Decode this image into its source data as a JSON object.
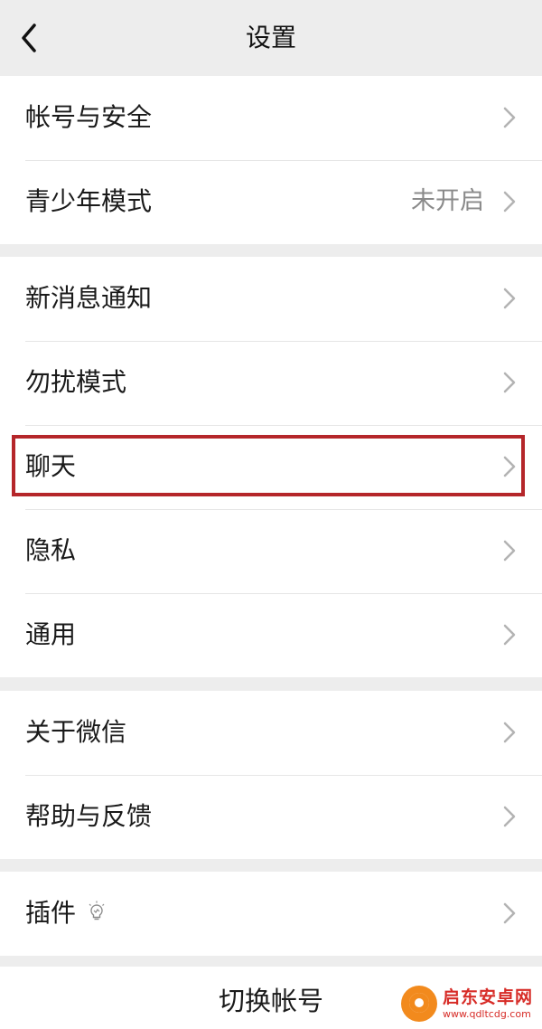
{
  "header": {
    "title": "设置"
  },
  "groups": [
    {
      "items": [
        {
          "label": "帐号与安全",
          "value": ""
        },
        {
          "label": "青少年模式",
          "value": "未开启"
        }
      ]
    },
    {
      "items": [
        {
          "label": "新消息通知",
          "value": ""
        },
        {
          "label": "勿扰模式",
          "value": ""
        },
        {
          "label": "聊天",
          "value": ""
        },
        {
          "label": "隐私",
          "value": ""
        },
        {
          "label": "通用",
          "value": ""
        }
      ]
    },
    {
      "items": [
        {
          "label": "关于微信",
          "value": ""
        },
        {
          "label": "帮助与反馈",
          "value": ""
        }
      ]
    },
    {
      "items": [
        {
          "label": "插件",
          "value": ""
        }
      ]
    }
  ],
  "footer": {
    "switch_account": "切换帐号"
  },
  "watermark": {
    "name": "启东安卓网",
    "url": "www.qdltcdg.com"
  },
  "colors": {
    "highlight": "#b5262a",
    "background": "#ededed",
    "secondary_text": "#8a8a8a"
  },
  "icons": {
    "back": "chevron-left-icon",
    "row_arrow": "chevron-right-icon",
    "plugin": "lightbulb-icon"
  }
}
